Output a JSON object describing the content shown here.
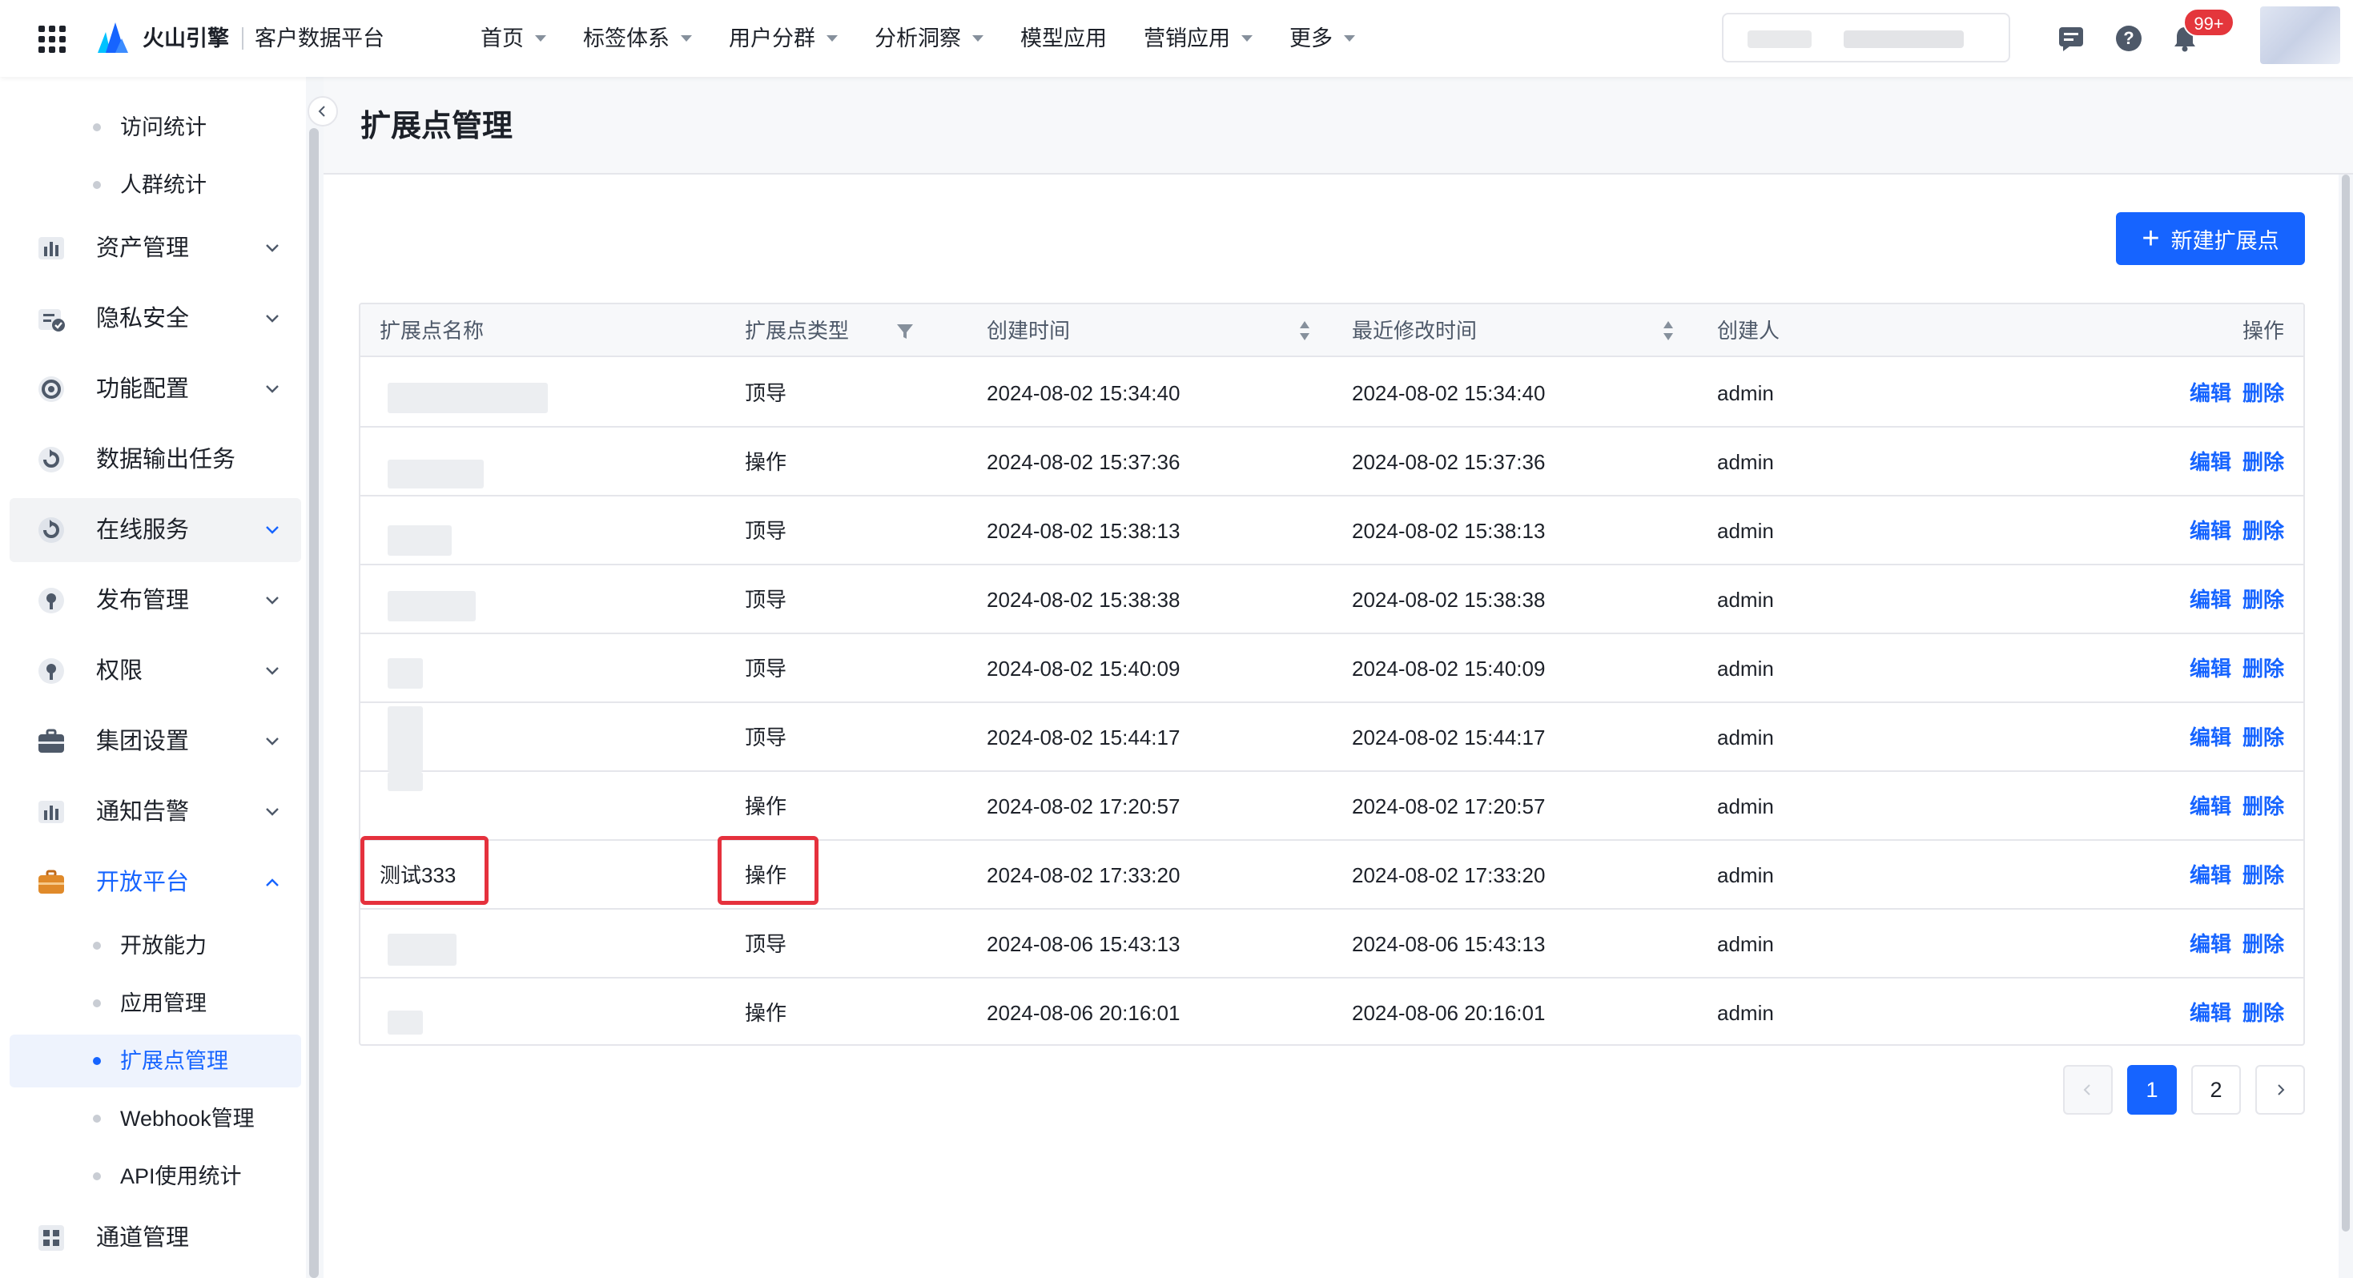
{
  "app": {
    "brand": "火山引擎",
    "product": "客户数据平台"
  },
  "nav": {
    "items": [
      {
        "label": "首页",
        "has_caret": true
      },
      {
        "label": "标签体系",
        "has_caret": true
      },
      {
        "label": "用户分群",
        "has_caret": true
      },
      {
        "label": "分析洞察",
        "has_caret": true
      },
      {
        "label": "模型应用",
        "has_caret": false
      },
      {
        "label": "营销应用",
        "has_caret": true
      },
      {
        "label": "更多",
        "has_caret": true
      }
    ],
    "notification_badge": "99+"
  },
  "sidebar": {
    "top_subitems": [
      {
        "label": "访问统计"
      },
      {
        "label": "人群统计"
      }
    ],
    "groups": [
      {
        "label": "资产管理",
        "icon": "bar-chart-icon"
      },
      {
        "label": "隐私安全",
        "icon": "shield-check-icon"
      },
      {
        "label": "功能配置",
        "icon": "settings-icon"
      },
      {
        "label": "数据输出任务",
        "icon": "export-icon"
      },
      {
        "label": "在线服务",
        "icon": "cloud-service-icon"
      },
      {
        "label": "发布管理",
        "icon": "publish-icon"
      },
      {
        "label": "权限",
        "icon": "lock-icon"
      },
      {
        "label": "集团设置",
        "icon": "briefcase-icon"
      },
      {
        "label": "通知告警",
        "icon": "bar-chart-icon"
      },
      {
        "label": "开放平台",
        "icon": "briefcase-icon"
      }
    ],
    "open_platform_items": [
      {
        "label": "开放能力"
      },
      {
        "label": "应用管理"
      },
      {
        "label": "扩展点管理"
      },
      {
        "label": "Webhook管理"
      },
      {
        "label": "API使用统计"
      }
    ],
    "bottom_group": {
      "label": "通道管理",
      "icon": "grid-icon"
    }
  },
  "page": {
    "title": "扩展点管理",
    "new_button": "新建扩展点"
  },
  "table": {
    "columns": [
      "扩展点名称",
      "扩展点类型",
      "创建时间",
      "最近修改时间",
      "创建人",
      "操作"
    ],
    "rows": [
      {
        "name": "",
        "type": "顶导",
        "created": "2024-08-02 15:34:40",
        "modified": "2024-08-02 15:34:40",
        "creator": "admin",
        "edit": "编辑",
        "delete": "删除"
      },
      {
        "name": "",
        "type": "操作",
        "created": "2024-08-02 15:37:36",
        "modified": "2024-08-02 15:37:36",
        "creator": "admin",
        "edit": "编辑",
        "delete": "删除"
      },
      {
        "name": "",
        "type": "顶导",
        "created": "2024-08-02 15:38:13",
        "modified": "2024-08-02 15:38:13",
        "creator": "admin",
        "edit": "编辑",
        "delete": "删除"
      },
      {
        "name": "",
        "type": "顶导",
        "created": "2024-08-02 15:38:38",
        "modified": "2024-08-02 15:38:38",
        "creator": "admin",
        "edit": "编辑",
        "delete": "删除"
      },
      {
        "name": "",
        "type": "顶导",
        "created": "2024-08-02 15:40:09",
        "modified": "2024-08-02 15:40:09",
        "creator": "admin",
        "edit": "编辑",
        "delete": "删除"
      },
      {
        "name": "",
        "type": "顶导",
        "created": "2024-08-02 15:44:17",
        "modified": "2024-08-02 15:44:17",
        "creator": "admin",
        "edit": "编辑",
        "delete": "删除"
      },
      {
        "name": "",
        "type": "操作",
        "created": "2024-08-02 17:20:57",
        "modified": "2024-08-02 17:20:57",
        "creator": "admin",
        "edit": "编辑",
        "delete": "删除"
      },
      {
        "name": "测试333",
        "type": "操作",
        "created": "2024-08-02 17:33:20",
        "modified": "2024-08-02 17:33:20",
        "creator": "admin",
        "edit": "编辑",
        "delete": "删除"
      },
      {
        "name": "",
        "type": "顶导",
        "created": "2024-08-06 15:43:13",
        "modified": "2024-08-06 15:43:13",
        "creator": "admin",
        "edit": "编辑",
        "delete": "删除"
      },
      {
        "name": "",
        "type": "操作",
        "created": "2024-08-06 20:16:01",
        "modified": "2024-08-06 20:16:01",
        "creator": "admin",
        "edit": "编辑",
        "delete": "删除"
      }
    ]
  },
  "pagination": {
    "pages": [
      "1",
      "2"
    ],
    "current": "1"
  },
  "colors": {
    "accent": "#1664ff",
    "highlight": "#e5313d",
    "badge": "#e4363c"
  }
}
